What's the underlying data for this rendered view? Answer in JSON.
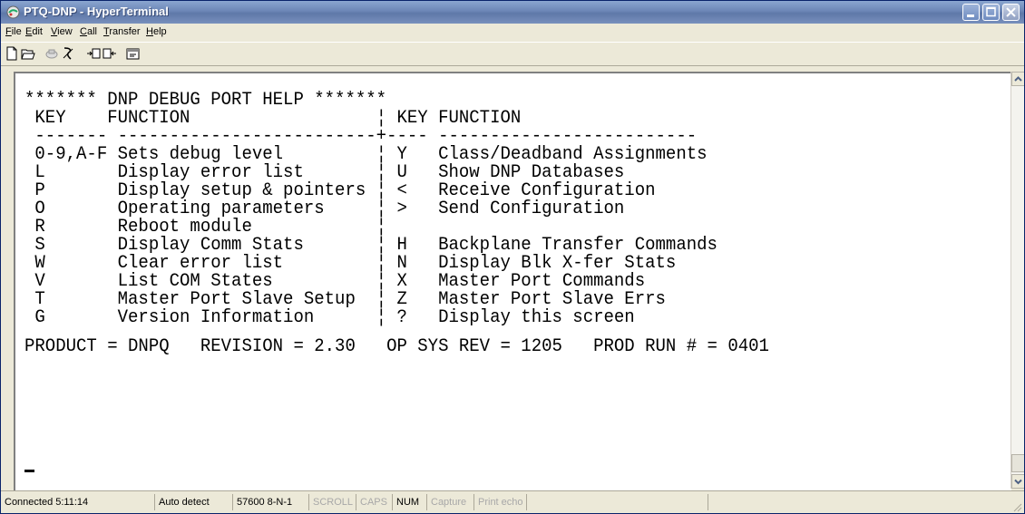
{
  "window": {
    "title": "PTQ-DNP - HyperTerminal"
  },
  "menu": [
    {
      "accel": "F",
      "rest": "ile"
    },
    {
      "accel": "E",
      "rest": "dit"
    },
    {
      "accel": "V",
      "rest": "iew"
    },
    {
      "accel": "C",
      "rest": "all"
    },
    {
      "accel": "T",
      "rest": "ransfer"
    },
    {
      "accel": "H",
      "rest": "elp"
    }
  ],
  "toolbar": {
    "icons": [
      "new-icon",
      "open-icon",
      "connect-icon",
      "disconnect-icon",
      "send-icon",
      "receive-icon",
      "properties-icon"
    ]
  },
  "terminal": {
    "lines": [
      "",
      "******* DNP DEBUG PORT HELP *******",
      " KEY    FUNCTION                  ¦ KEY FUNCTION",
      " ------- -------------------------+---- -------------------------",
      " 0-9,A-F Sets debug level         ¦ Y   Class/Deadband Assignments",
      " L       Display error list       ¦ U   Show DNP Databases",
      " P       Display setup & pointers ¦ <   Receive Configuration",
      " O       Operating parameters     ¦ >   Send Configuration",
      " R       Reboot module            ¦",
      " S       Display Comm Stats       ¦ H   Backplane Transfer Commands",
      " W       Clear error list         ¦ N   Display Blk X-fer Stats",
      " V       List COM States          ¦ X   Master Port Commands",
      " T       Master Port Slave Setup  ¦ Z   Master Port Slave Errs",
      " G       Version Information      ¦ ?   Display this screen",
      "",
      "PRODUCT = DNPQ   REVISION = 2.30   OP SYS REV = 1205   PROD RUN # = 0401"
    ]
  },
  "status": {
    "connected": "Connected 5:11:14",
    "detect": "Auto detect",
    "settings": "57600 8-N-1",
    "scroll": "SCROLL",
    "caps": "CAPS",
    "num": "NUM",
    "capture": "Capture",
    "print_echo": "Print echo"
  }
}
